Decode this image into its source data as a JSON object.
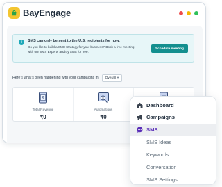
{
  "app": {
    "brand": "BayEngage",
    "window_dots": [
      "#ee4b4b",
      "#f5b800",
      "#2fc15a"
    ]
  },
  "banner": {
    "icon": "info-icon",
    "title": "SMS can only be sent to the U.S. recipients for now.",
    "body": "Do you like to build a SMS Strategy for your business? Book a free meeting with our SMS Experts and try SMS for free.",
    "button_label": "Schedule meeting"
  },
  "summary": {
    "text": "Here's what's been happening with your campaigns in",
    "period": "Overall"
  },
  "stats": [
    {
      "icon": "revenue-icon",
      "label": "Total Revenue",
      "value": "₹0"
    },
    {
      "icon": "automation-icon",
      "label": "Automations",
      "value": "₹0"
    },
    {
      "icon": "document-icon",
      "label": "",
      "value": ""
    }
  ],
  "menu": {
    "items": [
      {
        "icon": "home-icon",
        "label": "Dashboard"
      },
      {
        "icon": "megaphone-icon",
        "label": "Campaigns"
      },
      {
        "icon": "chat-icon",
        "label": "SMS",
        "active": true
      },
      {
        "label": "SMS Ideas"
      },
      {
        "label": "Keywords"
      },
      {
        "label": "Conversation"
      },
      {
        "label": "SMS Settings"
      }
    ]
  },
  "colors": {
    "accent_teal": "#138f8f",
    "active_purple": "#5b2fb8",
    "logo_yellow": "#f3c530"
  }
}
